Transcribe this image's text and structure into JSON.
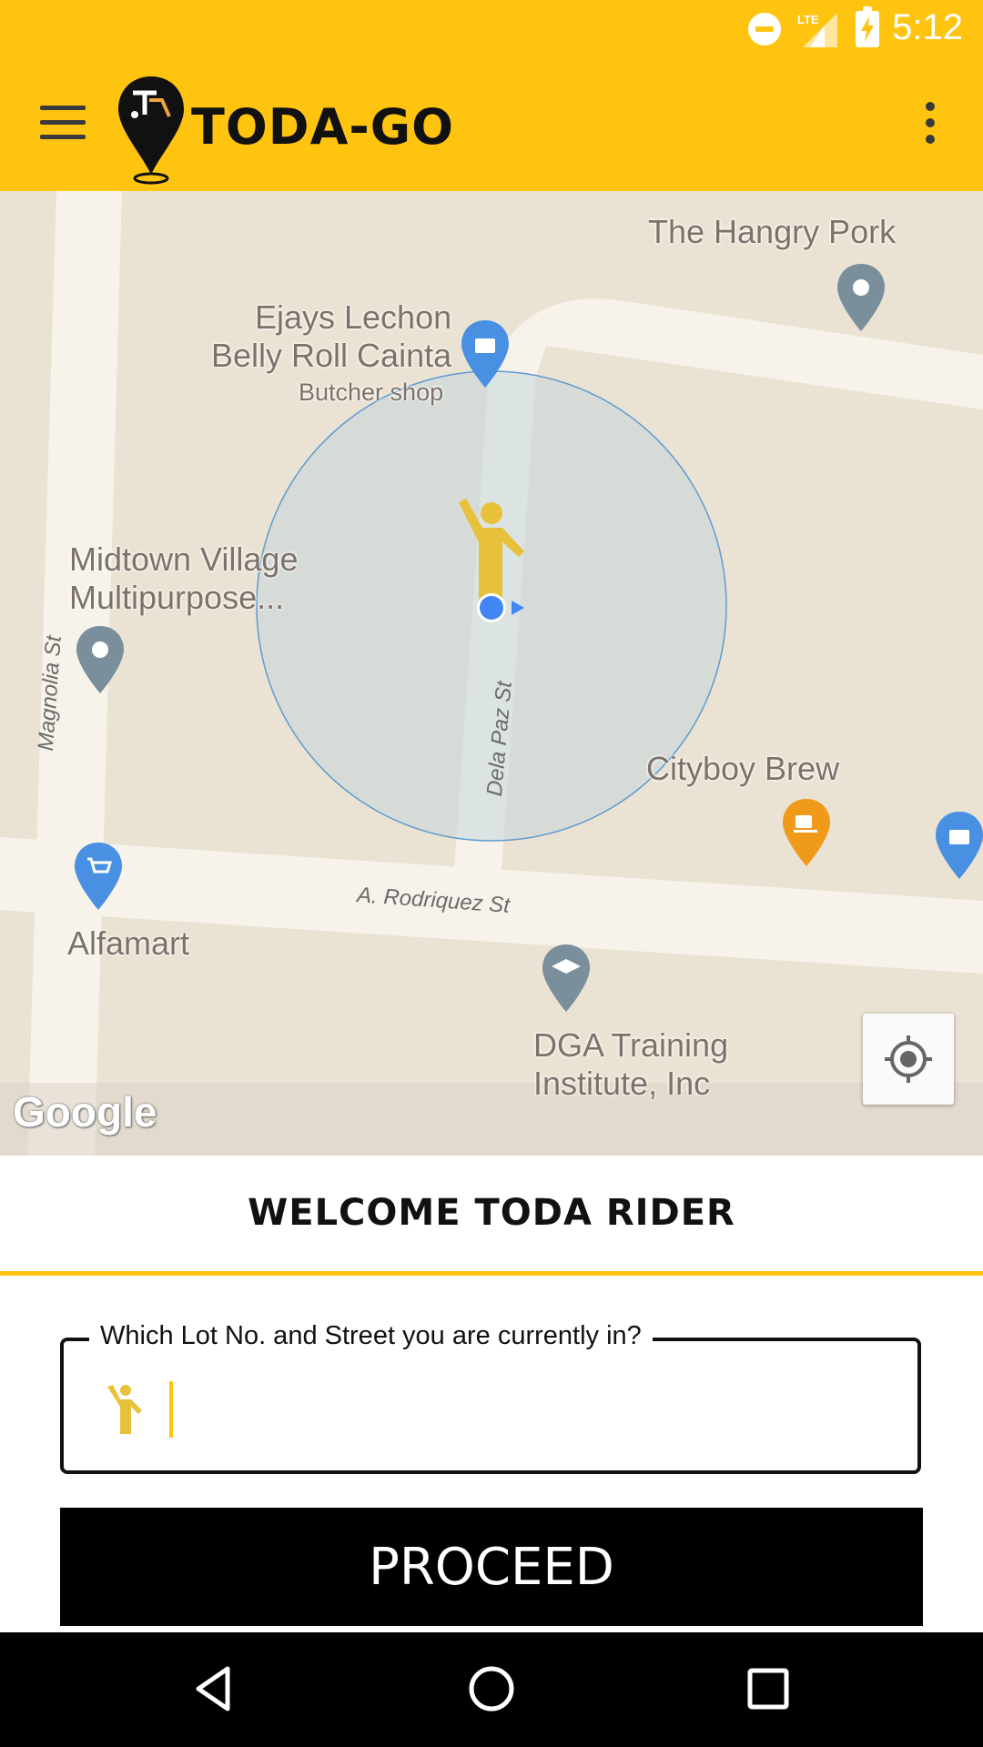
{
  "status_bar": {
    "time": "5:12",
    "network": "LTE",
    "icons": [
      "do-not-disturb-icon",
      "lte-signal-icon",
      "battery-charging-icon"
    ]
  },
  "app_bar": {
    "brand": "TODA-GO",
    "menu_icon": "hamburger-icon",
    "overflow_icon": "more-vert-icon",
    "color": "#FFC40F"
  },
  "map": {
    "places": [
      {
        "name": "The Hangry Pork"
      },
      {
        "name": "Ejays Lechon\nBelly Roll Cainta",
        "category": "Butcher shop"
      },
      {
        "name": "Midtown Village\nMultipurpose..."
      },
      {
        "name": "Cityboy Brew"
      },
      {
        "name": "Alfamart"
      },
      {
        "name": "DGA Training\nInstitute, Inc"
      }
    ],
    "streets": [
      "Magnolia St",
      "Dela Paz St",
      "A. Rodriquez St"
    ],
    "attribution": "Google",
    "locate_icon": "my-location-icon"
  },
  "panel": {
    "welcome": "WELCOME TODA RIDER",
    "field_label": "Which Lot No. and Street you are currently in?",
    "field_value": "",
    "proceed_label": "PROCEED"
  },
  "nav_bar": {
    "icons": [
      "back-icon",
      "home-icon",
      "recents-icon"
    ]
  }
}
